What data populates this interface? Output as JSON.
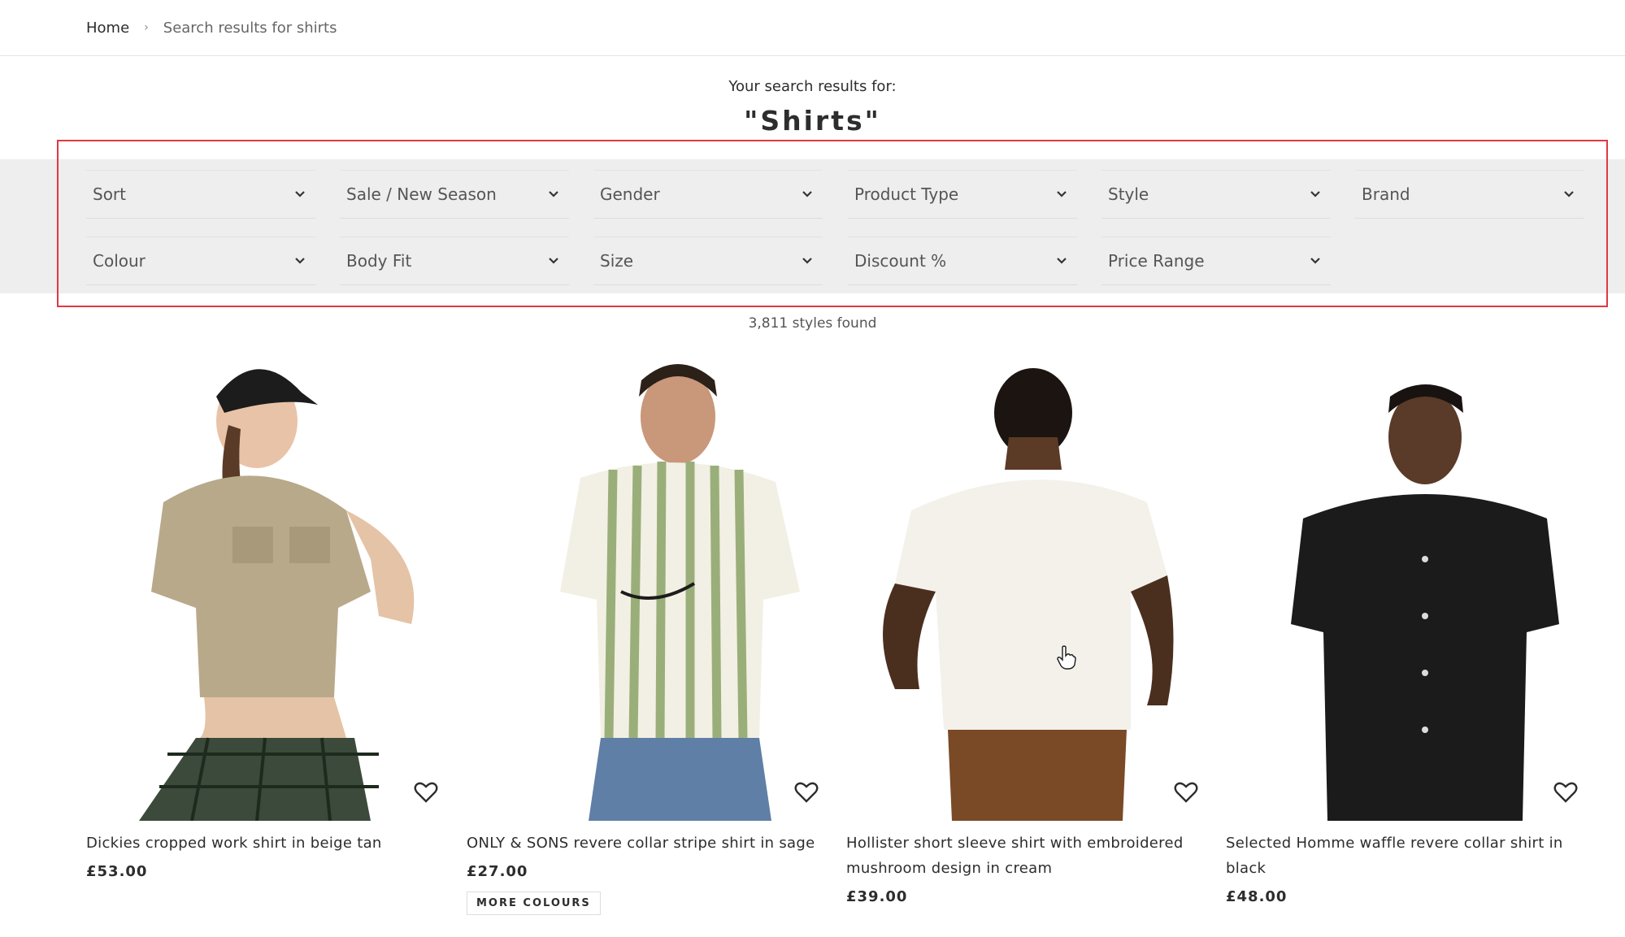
{
  "breadcrumb": {
    "home": "Home",
    "separator": "›",
    "current": "Search results for shirts"
  },
  "search": {
    "intro": "Your search results for:",
    "term": "\"Shirts\""
  },
  "filters": [
    {
      "label": "Sort",
      "icon": "chevron-down-icon"
    },
    {
      "label": "Sale / New Season",
      "icon": "chevron-down-icon"
    },
    {
      "label": "Gender",
      "icon": "chevron-down-icon"
    },
    {
      "label": "Product Type",
      "icon": "chevron-down-icon"
    },
    {
      "label": "Style",
      "icon": "chevron-down-icon"
    },
    {
      "label": "Brand",
      "icon": "chevron-down-icon"
    },
    {
      "label": "Colour",
      "icon": "chevron-down-icon"
    },
    {
      "label": "Body Fit",
      "icon": "chevron-down-icon"
    },
    {
      "label": "Size",
      "icon": "chevron-down-icon"
    },
    {
      "label": "Discount %",
      "icon": "chevron-down-icon"
    },
    {
      "label": "Price Range",
      "icon": "chevron-down-icon"
    }
  ],
  "results_count": "3,811 styles found",
  "products": [
    {
      "title": "Dickies cropped work shirt in beige tan",
      "price": "£53.00",
      "icon": "heart-icon"
    },
    {
      "title": "ONLY & SONS revere collar stripe shirt in sage",
      "price": "£27.00",
      "more_colours": "MORE COLOURS",
      "icon": "heart-icon"
    },
    {
      "title": "Hollister short sleeve shirt with embroidered mushroom design in cream",
      "price": "£39.00",
      "icon": "heart-icon"
    },
    {
      "title": "Selected Homme waffle revere collar shirt in black",
      "price": "£48.00",
      "icon": "heart-icon"
    }
  ],
  "colors": {
    "text": "#2d2d2d",
    "filter_band": "#eeeeee",
    "highlight": "#e0393f"
  }
}
